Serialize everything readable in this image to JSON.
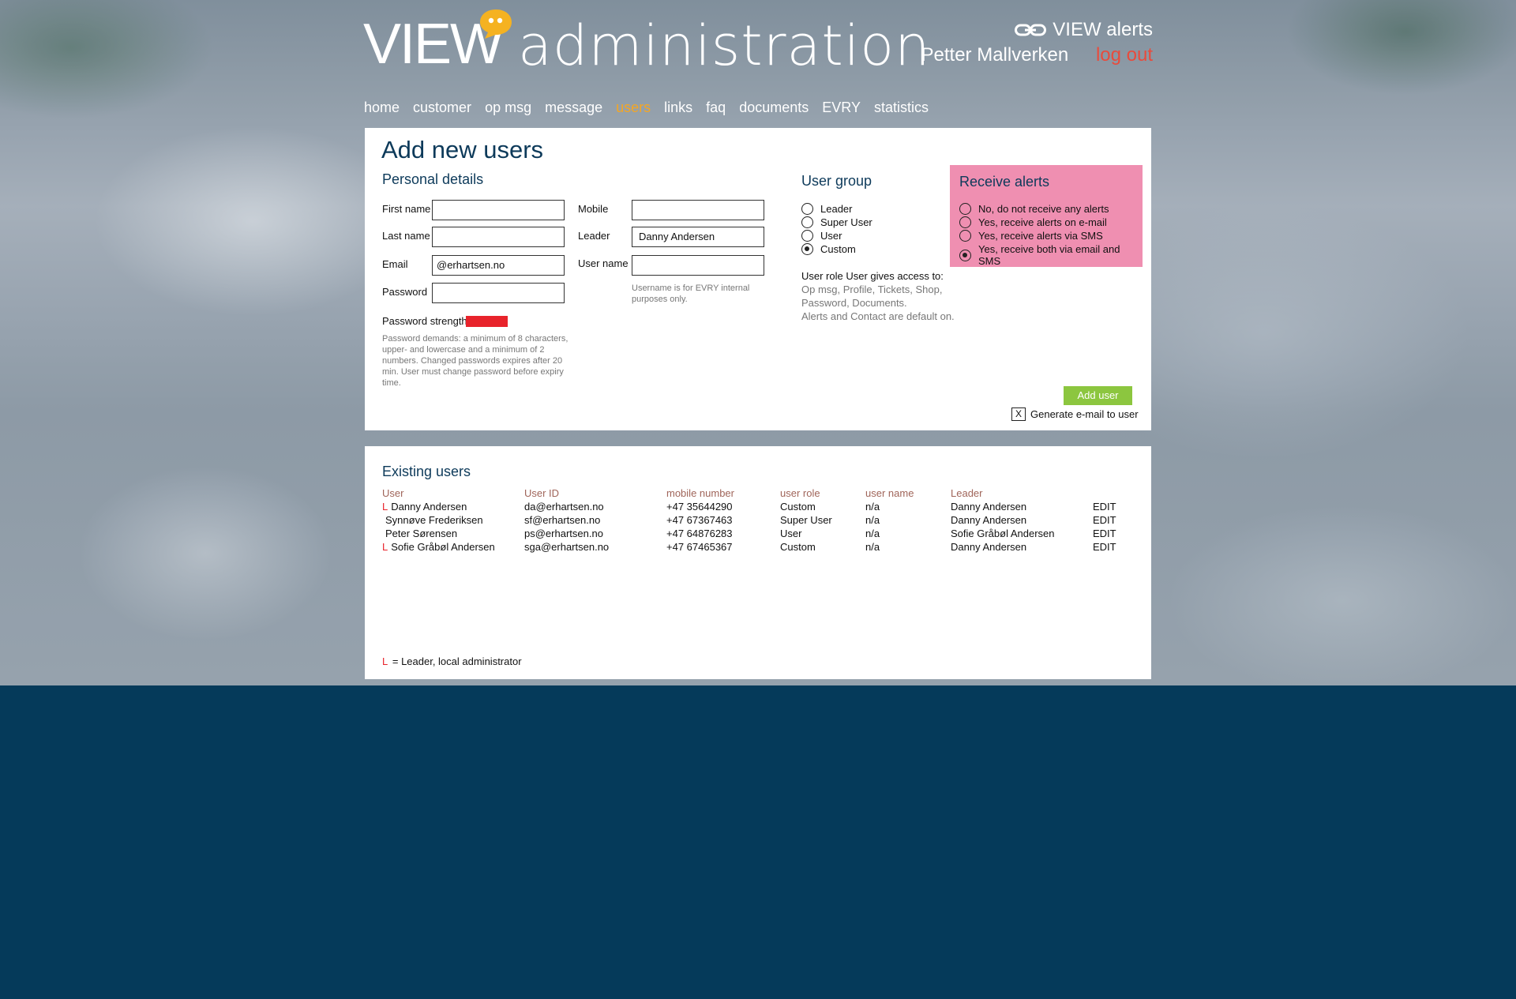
{
  "logo": {
    "view": "VIEW",
    "admin": "administration"
  },
  "header": {
    "alerts_label": "VIEW alerts",
    "user_name": "Petter Mallverken",
    "logout": "log out"
  },
  "nav": [
    {
      "label": "home",
      "active": false
    },
    {
      "label": "customer",
      "active": false
    },
    {
      "label": "op msg",
      "active": false
    },
    {
      "label": "message",
      "active": false
    },
    {
      "label": "users",
      "active": true
    },
    {
      "label": "links",
      "active": false
    },
    {
      "label": "faq",
      "active": false
    },
    {
      "label": "documents",
      "active": false
    },
    {
      "label": "EVRY",
      "active": false
    },
    {
      "label": "statistics",
      "active": false
    }
  ],
  "add_form": {
    "title": "Add new users",
    "personal_title": "Personal details",
    "labels": {
      "first_name": "First name",
      "last_name": "Last name",
      "email": "Email",
      "password": "Password",
      "mobile": "Mobile",
      "leader": "Leader",
      "user_name": "User name",
      "password_strength": "Password strength"
    },
    "values": {
      "first_name": "",
      "last_name": "",
      "email": "@erhartsen.no",
      "password": "",
      "mobile": "",
      "leader": "Danny Andersen",
      "user_name": ""
    },
    "username_note": "Username is for EVRY internal purposes only.",
    "password_note": "Password demands: a minimum of 8 characters, upper- and lowercase and a minimum of 2 numbers. Changed passwords expires after 20 min. User must change password before expiry time.",
    "user_group": {
      "title": "User group",
      "options": [
        "Leader",
        "Super User",
        "User",
        "Custom"
      ],
      "selected": "Custom"
    },
    "role_text": "User role User gives access to:",
    "role_access": "Op msg, Profile, Tickets, Shop, Password, Documents.",
    "role_default": "Alerts and Contact are default on.",
    "receive_alerts": {
      "title": "Receive alerts",
      "options": [
        "No, do not receive any alerts",
        "Yes, receive alerts on e-mail",
        "Yes, receive alerts via SMS",
        "Yes, receive both via email and SMS"
      ],
      "selected": "Yes, receive both via email and SMS"
    },
    "add_button": "Add user",
    "generate_checkbox_mark": "X",
    "generate_label": "Generate e-mail to user"
  },
  "existing": {
    "title": "Existing users",
    "columns": [
      "User",
      "User ID",
      "mobile number",
      "user role",
      "user name",
      "Leader"
    ],
    "rows": [
      {
        "leader_mark": "L",
        "user": "Danny Andersen",
        "id": "da@erhartsen.no",
        "mobile": "+47 35644290",
        "role": "Custom",
        "username": "n/a",
        "leader": "Danny Andersen",
        "edit": "EDIT"
      },
      {
        "leader_mark": "",
        "user": "Synnøve Frederiksen",
        "id": "sf@erhartsen.no",
        "mobile": "+47 67367463",
        "role": "Super User",
        "username": "n/a",
        "leader": "Danny Andersen",
        "edit": "EDIT"
      },
      {
        "leader_mark": "",
        "user": "Peter Sørensen",
        "id": "ps@erhartsen.no",
        "mobile": "+47 64876283",
        "role": "User",
        "username": "n/a",
        "leader": "Sofie Gråbøl Andersen",
        "edit": "EDIT"
      },
      {
        "leader_mark": "L",
        "user": "Sofie Gråbøl Andersen",
        "id": "sga@erhartsen.no",
        "mobile": "+47 67465367",
        "role": "Custom",
        "username": "n/a",
        "leader": "Danny Andersen",
        "edit": "EDIT"
      }
    ],
    "legend_mark": "L",
    "legend_text": "= Leader, local administrator"
  },
  "colors": {
    "background": "#053a5a",
    "accent_active": "#f5a623",
    "logout": "#e94b3c",
    "add_button": "#8cc63f",
    "alerts_box": "#ef8fb1",
    "strength_bar": "#e8232b"
  },
  "icons": {
    "alerts": "chain-link-icon",
    "logo": "speech-bubble-icon"
  }
}
